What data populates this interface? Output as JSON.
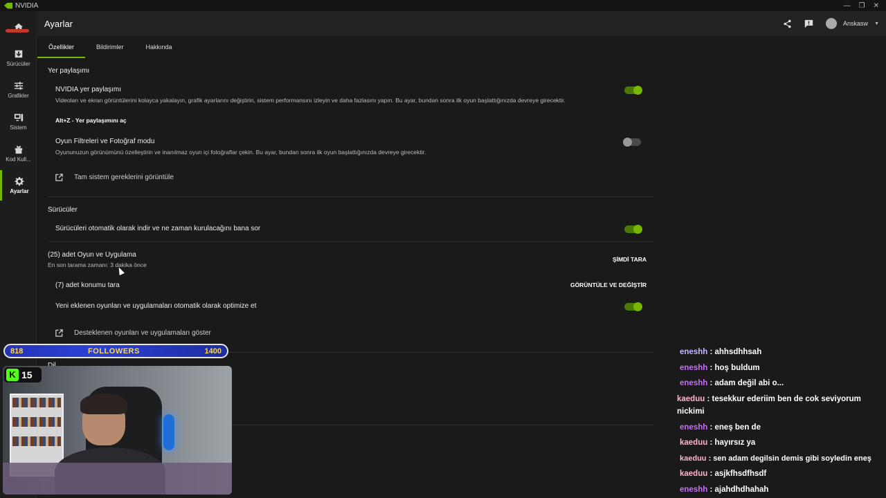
{
  "titlebar": {
    "app": "NVIDIA",
    "minimize": "—",
    "restore": "❐",
    "close": "✕"
  },
  "sidebar": {
    "items": [
      {
        "label": ""
      },
      {
        "label": "Sürücüler"
      },
      {
        "label": "Grafikler"
      },
      {
        "label": "Sistem"
      },
      {
        "label": "Kod Kull..."
      },
      {
        "label": "Ayarlar"
      }
    ]
  },
  "header": {
    "title": "Ayarlar",
    "user": "Anskasw"
  },
  "tabs": [
    "Özellikler",
    "Bildirimler",
    "Hakkında"
  ],
  "overlay": {
    "section": "Yer paylaşımı",
    "nvidia_title": "NVIDIA yer paylaşımı",
    "nvidia_desc": "Videoları ve ekran görüntülerini kolayca yakalayın, grafik ayarlarını değiştirin, sistem performansını izleyin ve daha fazlasını yapın. Bu ayar, bundan sonra ilk oyun başlattığınızda devreye girecektir.",
    "shortcut": "Alt+Z - Yer paylaşımını aç",
    "filters_title": "Oyun Filtreleri ve Fotoğraf modu",
    "filters_desc": "Oyununuzun görünümünü özelleştirin ve inanılmaz oyun içi fotoğraflar çekin. Bu ayar, bundan sonra ilk oyun başlattığınızda devreye girecektir.",
    "requirements_link": "Tam sistem gereklerini görüntüle"
  },
  "drivers": {
    "section": "Sürücüler",
    "auto_download": "Sürücüleri otomatik olarak indir ve ne zaman kurulacağını bana sor"
  },
  "games": {
    "title": "(25) adet Oyun ve Uygulama",
    "last_scan": "En son tarama zamanı: 3 dakika önce",
    "scan_now": "ŞİMDİ TARA",
    "locations": "(7) adet konumu tara",
    "view_edit": "GÖRÜNTÜLE VE DEĞİŞTİR",
    "auto_optimize": "Yeni eklenen oyunları ve uygulamaları otomatik olarak optimize et",
    "supported_link": "Desteklenen oyunları ve uygulamaları göster"
  },
  "language_section": "Dil",
  "toggles": {
    "nvidia_overlay": true,
    "photo_mode": false,
    "auto_drivers": true,
    "auto_optimize": true
  },
  "stream": {
    "followers_current": "818",
    "followers_label": "FOLLOWERS",
    "followers_goal": "1400",
    "kick_logo": "K",
    "viewers": "15"
  },
  "chat": [
    {
      "user": "eneshh",
      "sep": " : ",
      "msg": "ahhsdhhsah",
      "color": "lblue"
    },
    {
      "user": "eneshh",
      "sep": " : ",
      "msg": "hoş buldum",
      "color": "purple"
    },
    {
      "user": "eneshh",
      "sep": " : ",
      "msg": "adam değil abi o...",
      "color": "purple"
    },
    {
      "user": "kaeduu",
      "sep": " : ",
      "msg": "tesekkur ederiim ben de cok seviyorum nickimi",
      "color": "pink"
    },
    {
      "user": "eneshh",
      "sep": " : ",
      "msg": "eneş ben de",
      "color": "purple"
    },
    {
      "user": "kaeduu",
      "sep": " : ",
      "msg": "hayırsız ya",
      "color": "pink"
    },
    {
      "user": "kaeduu",
      "sep": " : ",
      "msg": "sen adam degilsin demis gibi soyledin eneş",
      "color": "pink"
    },
    {
      "user": "kaeduu",
      "sep": " : ",
      "msg": "asjkfhsdfhsdf",
      "color": "pink"
    },
    {
      "user": "eneshh",
      "sep": " : ",
      "msg": "ajahdhdhahah",
      "color": "purple"
    }
  ],
  "colors": {
    "accent": "#76b900",
    "chat_purple": "#c76cff",
    "chat_pink": "#ffb3d1",
    "followers_bar": "#2b41d6"
  }
}
